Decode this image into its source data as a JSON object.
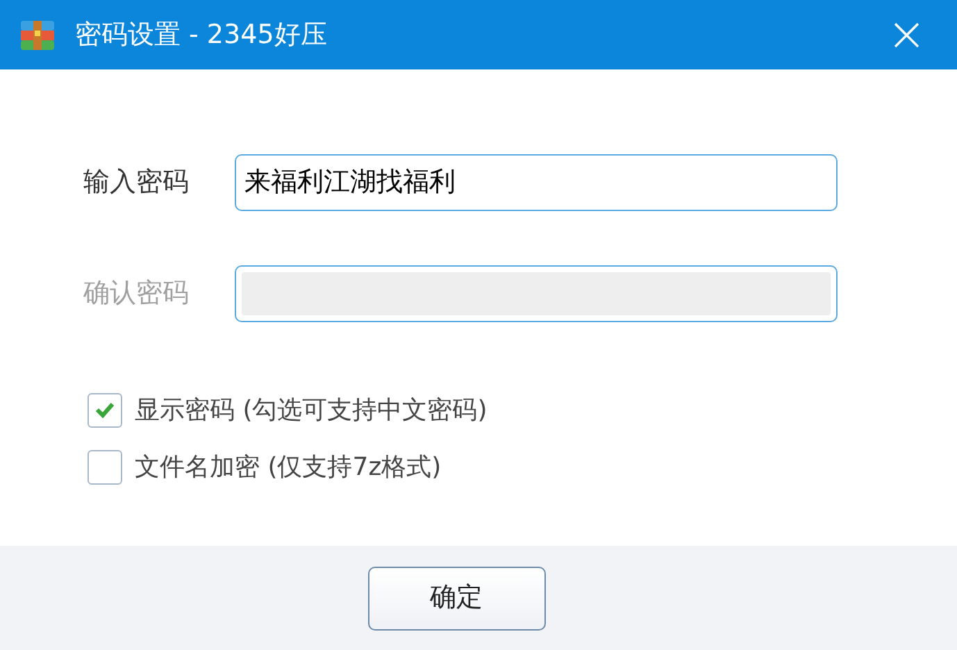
{
  "window": {
    "title": "密码设置 - 2345好压",
    "close": "×"
  },
  "fields": [
    {
      "label": "输入密码",
      "value": "来福利江湖找福利",
      "disabled": false
    },
    {
      "label": "确认密码",
      "disabled": true
    }
  ],
  "checkboxes": [
    {
      "label": "显示密码 (勾选可支持中文密码)",
      "checked": true
    },
    {
      "label": "文件名加密 (仅支持7z格式)",
      "checked": false
    }
  ],
  "buttons": [
    "确定"
  ]
}
